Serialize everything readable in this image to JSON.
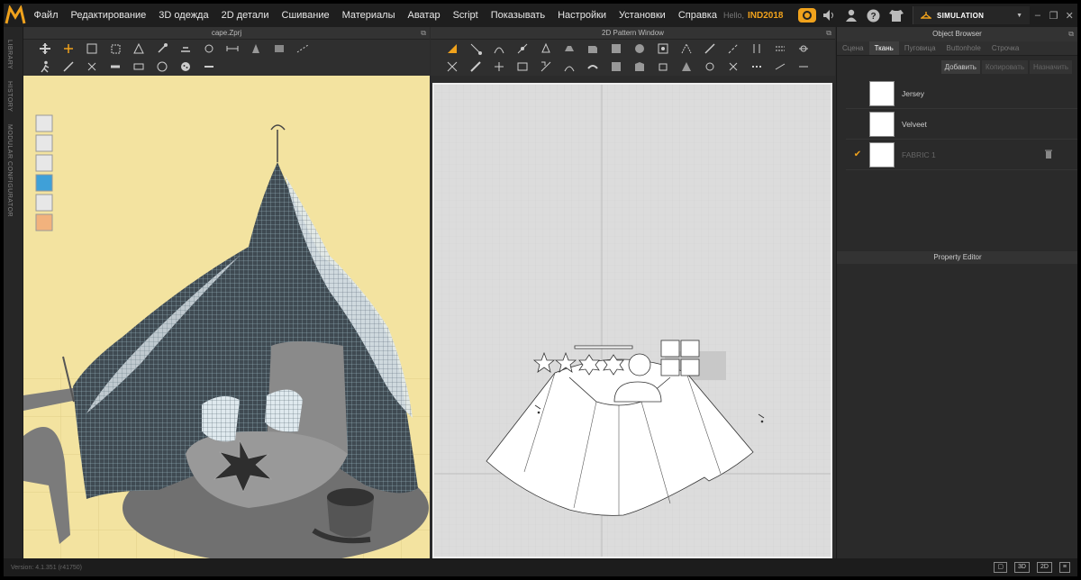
{
  "app": {
    "menu": [
      "Файл",
      "Редактирование",
      "3D одежда",
      "2D детали",
      "Сшивание",
      "Материалы",
      "Аватар",
      "Script",
      "Показывать",
      "Настройки",
      "Установки",
      "Справка"
    ],
    "hello_label": "Hello,",
    "user_name": "IND2018",
    "mode_label": "SIMULATION"
  },
  "left_tabs": [
    "LIBRARY",
    "HISTORY",
    "MODULAR CONFIGURATOR"
  ],
  "window3d": {
    "title": "cape.Zprj"
  },
  "window2d": {
    "title": "2D Pattern Window"
  },
  "object_browser": {
    "title": "Object Browser",
    "tabs": [
      "Сцена",
      "Ткань",
      "Пуговица",
      "Buttonhole",
      "Строчка"
    ],
    "active_tab": "Ткань",
    "buttons": [
      "Добавить",
      "Копировать",
      "Назначить"
    ],
    "fabrics": [
      {
        "name": "Jersey",
        "active": false
      },
      {
        "name": "Velveet",
        "active": false
      },
      {
        "name": "FABRIC 1",
        "active": true
      }
    ]
  },
  "property_editor": {
    "title": "Property Editor"
  },
  "status": {
    "version": "Version: 4.1.351 (r41750)",
    "view_buttons": [
      "3D",
      "2D"
    ]
  },
  "colors": {
    "accent": "#f0a21c",
    "background_3d": "#f3e3a0",
    "background_2d": "#dcdcdc",
    "panel": "#2b2b2b"
  }
}
